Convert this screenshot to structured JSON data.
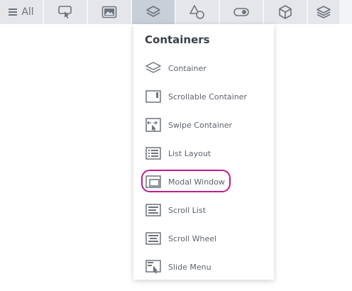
{
  "toolbar": {
    "all_label": "All",
    "tabs": [
      {
        "icon": "touch-icon"
      },
      {
        "icon": "image-icon"
      },
      {
        "icon": "layers-icon",
        "active": true
      },
      {
        "icon": "shapes-icon"
      },
      {
        "icon": "toggle-icon"
      },
      {
        "icon": "cube-icon"
      },
      {
        "icon": "stack-icon"
      }
    ]
  },
  "dropdown": {
    "title": "Containers",
    "items": [
      {
        "label": "Container",
        "icon": "layers-icon"
      },
      {
        "label": "Scrollable Container",
        "icon": "scrollable-container-icon"
      },
      {
        "label": "Swipe Container",
        "icon": "swipe-container-icon"
      },
      {
        "label": "List Layout",
        "icon": "list-layout-icon"
      },
      {
        "label": "Modal Window",
        "icon": "modal-window-icon",
        "highlighted": true
      },
      {
        "label": "Scroll List",
        "icon": "scroll-list-icon"
      },
      {
        "label": "Scroll Wheel",
        "icon": "scroll-wheel-icon"
      },
      {
        "label": "Slide Menu",
        "icon": "slide-menu-icon"
      }
    ]
  },
  "colors": {
    "tab_bg": "#e4e6ea",
    "tab_active_bg": "#c9cfd8",
    "icon": "#6d737d",
    "highlight": "#c01c8c"
  }
}
